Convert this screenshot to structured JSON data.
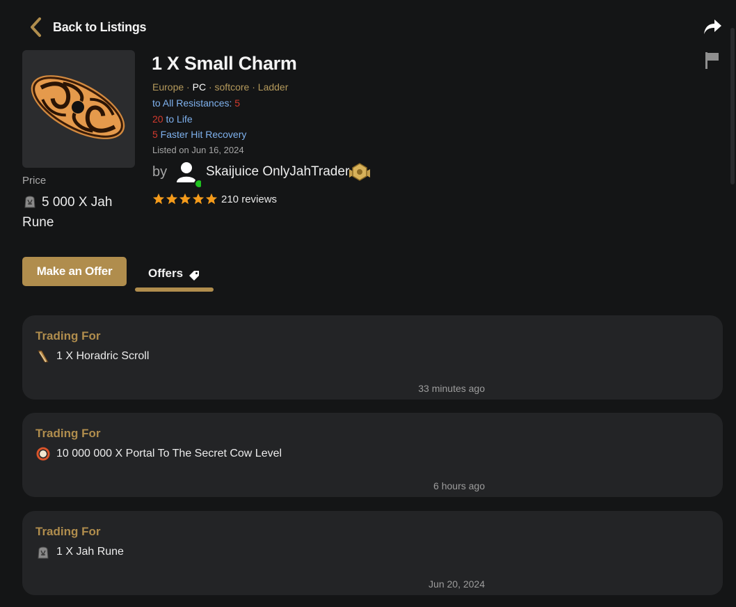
{
  "nav": {
    "back_label": "Back to Listings"
  },
  "listing": {
    "title": "1 X Small Charm",
    "meta": {
      "region": "Europe",
      "platform": "PC",
      "mode": "softcore",
      "season": "Ladder",
      "sep": " · "
    },
    "properties": [
      {
        "prefix": "",
        "text": "to All Resistances: ",
        "value": "5"
      },
      {
        "prefix": "20",
        "text": " to Life",
        "value": ""
      },
      {
        "prefix": "5",
        "text": " Faster Hit Recovery",
        "value": ""
      }
    ],
    "listed": "Listed on Jun 16, 2024",
    "by_label": "by",
    "seller": {
      "name": "Skaijuice OnlyJahTrader",
      "online": true
    },
    "rating": {
      "stars": 5,
      "reviews": "210 reviews"
    },
    "price": {
      "label": "Price",
      "value": "5 000 X Jah Rune"
    }
  },
  "actions": {
    "make_offer": "Make an Offer",
    "offers_tab": "Offers"
  },
  "offers": [
    {
      "heading": "Trading For",
      "item": "1 X Horadric Scroll",
      "icon": "horadric-scroll-icon",
      "time": "33 minutes ago"
    },
    {
      "heading": "Trading For",
      "item": "10 000 000 X Portal To The Secret Cow Level",
      "icon": "portal-icon",
      "time": "6 hours ago"
    },
    {
      "heading": "Trading For",
      "item": "1 X Jah Rune",
      "icon": "jah-rune-icon",
      "time": "Jun 20, 2024"
    }
  ],
  "colors": {
    "accent": "#b08d4d",
    "background": "#141516",
    "card": "#232426",
    "prop_blue": "#7fb2ef",
    "prop_red": "#d33a2e",
    "online": "#1fc21f"
  }
}
